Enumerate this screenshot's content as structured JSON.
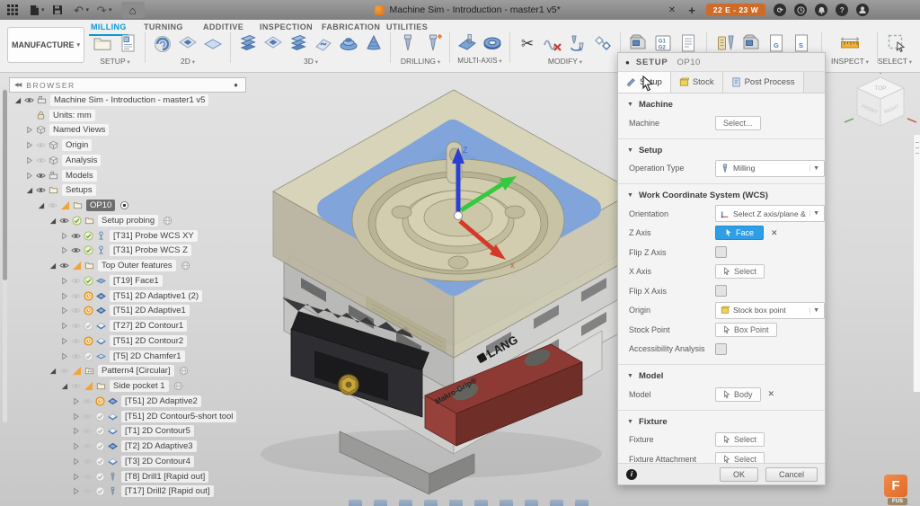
{
  "icons": {
    "undo": "↶",
    "redo": "↷",
    "home": "⌂",
    "close": "✕",
    "plus": "+",
    "collapse": "◀◀",
    "browser_dot": "●",
    "scissors": "✂",
    "info": "i"
  },
  "titlebar": {
    "title": "Machine Sim - Introduction - master1 v5*",
    "energy_badge": "22 E - 23 W"
  },
  "ribbon": {
    "workspace": "MANUFACTURE",
    "tabs": [
      {
        "label": "MILLING",
        "active": true
      },
      {
        "label": "TURNING"
      },
      {
        "label": "ADDITIVE"
      },
      {
        "label": "INSPECTION"
      },
      {
        "label": "FABRICATION"
      },
      {
        "label": "UTILITIES"
      }
    ],
    "groups": {
      "setup": "SETUP",
      "d2": "2D",
      "d3": "3D",
      "drilling": "DRILLING",
      "multiaxis": "MULTI-AXIS",
      "modify": "MODIFY",
      "inspect": "INSPECT",
      "select": "SELECT"
    }
  },
  "browser": {
    "header": "BROWSER",
    "tree": [
      {
        "d": 0,
        "caret": "exp",
        "vis": "on",
        "status": "",
        "type": "machine",
        "label": "Machine Sim - Introduction - master1 v5",
        "extra": ""
      },
      {
        "d": 1,
        "caret": "",
        "vis": "",
        "status": "",
        "type": "units",
        "label": "Units: mm",
        "extra": ""
      },
      {
        "d": 1,
        "caret": "col",
        "vis": "",
        "status": "",
        "type": "box",
        "label": "Named Views",
        "extra": ""
      },
      {
        "d": 1,
        "caret": "col",
        "vis": "off",
        "status": "",
        "type": "box",
        "label": "Origin",
        "extra": ""
      },
      {
        "d": 1,
        "caret": "col",
        "vis": "off",
        "status": "",
        "type": "box",
        "label": "Analysis",
        "extra": ""
      },
      {
        "d": 1,
        "caret": "col",
        "vis": "on",
        "status": "",
        "type": "machine",
        "label": "Models",
        "extra": ""
      },
      {
        "d": 1,
        "caret": "exp",
        "vis": "on",
        "status": "",
        "type": "folder",
        "label": "Setups",
        "extra": ""
      },
      {
        "d": 2,
        "caret": "exp",
        "vis": "off",
        "status": "warn",
        "type": "folder",
        "label": "OP10",
        "extra": "record",
        "sel": true
      },
      {
        "d": 3,
        "caret": "exp",
        "vis": "on",
        "status": "check",
        "type": "folder",
        "label": "Setup probing",
        "extra": "globe"
      },
      {
        "d": 4,
        "caret": "col",
        "vis": "on",
        "status": "check",
        "type": "probe",
        "label": "[T31] Probe WCS XY",
        "extra": ""
      },
      {
        "d": 4,
        "caret": "col",
        "vis": "on",
        "status": "check",
        "type": "probe",
        "label": "[T31] Probe WCS Z",
        "extra": ""
      },
      {
        "d": 3,
        "caret": "exp",
        "vis": "on",
        "status": "warn",
        "type": "folder",
        "label": "Top Outer features",
        "extra": "globe"
      },
      {
        "d": 4,
        "caret": "col",
        "vis": "off",
        "status": "check",
        "type": "face",
        "label": "[T19] Face1",
        "extra": ""
      },
      {
        "d": 4,
        "caret": "col",
        "vis": "off",
        "status": "clock",
        "type": "adaptive",
        "label": "[T51] 2D Adaptive1 (2)",
        "extra": ""
      },
      {
        "d": 4,
        "caret": "col",
        "vis": "off",
        "status": "clock",
        "type": "adaptive",
        "label": "[T51] 2D Adaptive1",
        "extra": ""
      },
      {
        "d": 4,
        "caret": "col",
        "vis": "off",
        "status": "checkdim",
        "type": "contour",
        "label": "[T27] 2D Contour1",
        "extra": ""
      },
      {
        "d": 4,
        "caret": "col",
        "vis": "off",
        "status": "clock",
        "type": "contour",
        "label": "[T51] 2D Contour2",
        "extra": ""
      },
      {
        "d": 4,
        "caret": "col",
        "vis": "off",
        "status": "checkdim",
        "type": "chamfer",
        "label": "[T5] 2D Chamfer1",
        "extra": ""
      },
      {
        "d": 3,
        "caret": "exp",
        "vis": "off",
        "status": "warn",
        "type": "pattern",
        "label": "Pattern4 [Circular]",
        "extra": "globe"
      },
      {
        "d": 4,
        "caret": "exp",
        "vis": "off",
        "status": "warn",
        "type": "folder",
        "label": "Side pocket 1",
        "extra": "globe"
      },
      {
        "d": 5,
        "caret": "col",
        "vis": "off",
        "status": "clock",
        "type": "adaptive",
        "label": "[T51] 2D Adaptive2",
        "extra": ""
      },
      {
        "d": 5,
        "caret": "col",
        "vis": "off",
        "status": "checkdim",
        "type": "contour",
        "label": "[T51] 2D Contour5-short tool",
        "extra": ""
      },
      {
        "d": 5,
        "caret": "col",
        "vis": "off",
        "status": "checkdim",
        "type": "contour",
        "label": "[T1] 2D Contour5",
        "extra": ""
      },
      {
        "d": 5,
        "caret": "col",
        "vis": "off",
        "status": "checkdim",
        "type": "adaptive",
        "label": "[T2] 2D Adaptive3",
        "extra": ""
      },
      {
        "d": 5,
        "caret": "col",
        "vis": "off",
        "status": "checkdim",
        "type": "contour",
        "label": "[T3] 2D Contour4",
        "extra": ""
      },
      {
        "d": 5,
        "caret": "col",
        "vis": "off",
        "status": "checkdim",
        "type": "drill",
        "label": "[T8] Drill1 [Rapid out]",
        "extra": ""
      },
      {
        "d": 5,
        "caret": "col",
        "vis": "off",
        "status": "checkdim",
        "type": "drill",
        "label": "[T17] Drill2 [Rapid out]",
        "extra": ""
      }
    ]
  },
  "viewport": {
    "viewcube": {
      "top": "TOP",
      "front": "FRONT",
      "right": "RIGHT"
    },
    "triad": {
      "z": "Z",
      "x": "x"
    },
    "model": {
      "brand": "LANG",
      "grip": "Makro-Grip®"
    },
    "watermark": {
      "letter": "F",
      "label": "FUS"
    }
  },
  "dialog": {
    "panel_label": "SETUP",
    "panel_value": "OP10",
    "tabs": [
      {
        "label": "Setup",
        "active": true
      },
      {
        "label": "Stock"
      },
      {
        "label": "Post Process"
      }
    ],
    "machine": {
      "title": "Machine",
      "machine_label": "Machine",
      "machine_button": "Select..."
    },
    "setup": {
      "title": "Setup",
      "operation_type_label": "Operation Type",
      "operation_type_value": "Milling"
    },
    "wcs": {
      "title": "Work Coordinate System (WCS)",
      "orientation_label": "Orientation",
      "orientation_value": "Select Z axis/plane & X axi...",
      "z_axis_label": "Z Axis",
      "z_axis_value": "Face",
      "flip_z_label": "Flip Z Axis",
      "x_axis_label": "X Axis",
      "x_axis_button": "Select",
      "flip_x_label": "Flip X Axis",
      "origin_label": "Origin",
      "origin_value": "Stock box point",
      "stock_point_label": "Stock Point",
      "stock_point_button": "Box Point",
      "accessibility_label": "Accessibility Analysis"
    },
    "model": {
      "title": "Model",
      "model_label": "Model",
      "model_button": "Body"
    },
    "fixture": {
      "title": "Fixture",
      "fixture_label": "Fixture",
      "fixture_button": "Select",
      "attachment_label": "Fixture Attachment",
      "attachment_button": "Select"
    },
    "footer": {
      "ok": "OK",
      "cancel": "Cancel"
    }
  }
}
